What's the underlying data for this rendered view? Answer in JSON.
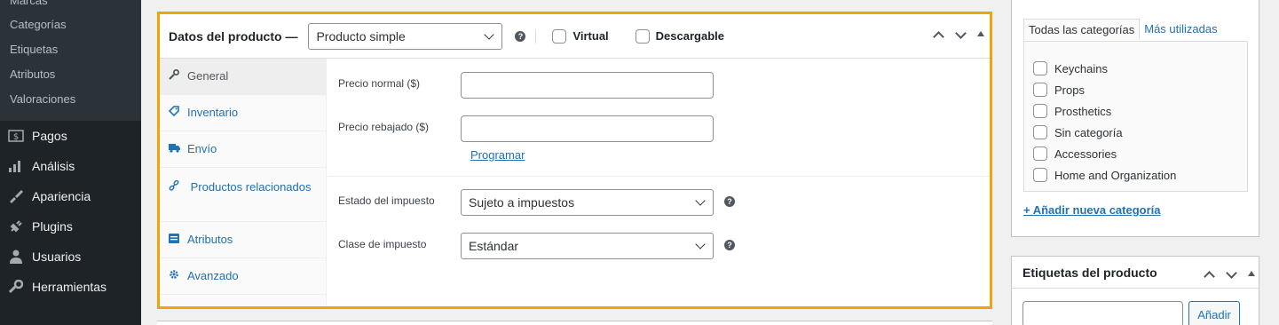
{
  "admin_menu": {
    "submenu": [
      "Marcas",
      "Categorías",
      "Etiquetas",
      "Atributos",
      "Valoraciones"
    ],
    "items": [
      {
        "label": "Pagos",
        "icon": "dollar-box-icon"
      },
      {
        "label": "Análisis",
        "icon": "bar-chart-icon"
      },
      {
        "label": "Apariencia",
        "icon": "paintbrush-icon"
      },
      {
        "label": "Plugins",
        "icon": "plug-icon"
      },
      {
        "label": "Usuarios",
        "icon": "user-icon"
      },
      {
        "label": "Herramientas",
        "icon": "wrench-icon"
      }
    ]
  },
  "product_data": {
    "title": "Datos del producto —",
    "type_select": "Producto simple",
    "virtual_label": "Virtual",
    "downloadable_label": "Descargable",
    "tabs": [
      {
        "label": "General",
        "icon": "wrench-icon"
      },
      {
        "label": "Inventario",
        "icon": "tag-icon"
      },
      {
        "label": "Envío",
        "icon": "truck-icon"
      },
      {
        "label": "Productos relacionados",
        "icon": "link-icon"
      },
      {
        "label": "Atributos",
        "icon": "list-icon"
      },
      {
        "label": "Avanzado",
        "icon": "gear-icon"
      }
    ],
    "general": {
      "regular_price_label": "Precio normal ($)",
      "regular_price_value": "",
      "sale_price_label": "Precio rebajado ($)",
      "sale_price_value": "",
      "schedule_link": "Programar",
      "tax_status_label": "Estado del impuesto",
      "tax_status_value": "Sujeto a impuestos",
      "tax_class_label": "Clase de impuesto",
      "tax_class_value": "Estándar"
    }
  },
  "categories": {
    "tab_all": "Todas las categorías",
    "tab_popular": "Más utilizadas",
    "items": [
      "Keychains",
      "Props",
      "Prosthetics",
      "Sin categoría",
      "Accessories",
      "Home and Organization"
    ],
    "add_link": "+ Añadir nueva categoría"
  },
  "tags": {
    "title": "Etiquetas del producto",
    "input_value": "",
    "add_button": "Añadir"
  },
  "colors": {
    "highlight": "#f0a30a",
    "link": "#2271b1",
    "sidebar": "#1d2327"
  }
}
